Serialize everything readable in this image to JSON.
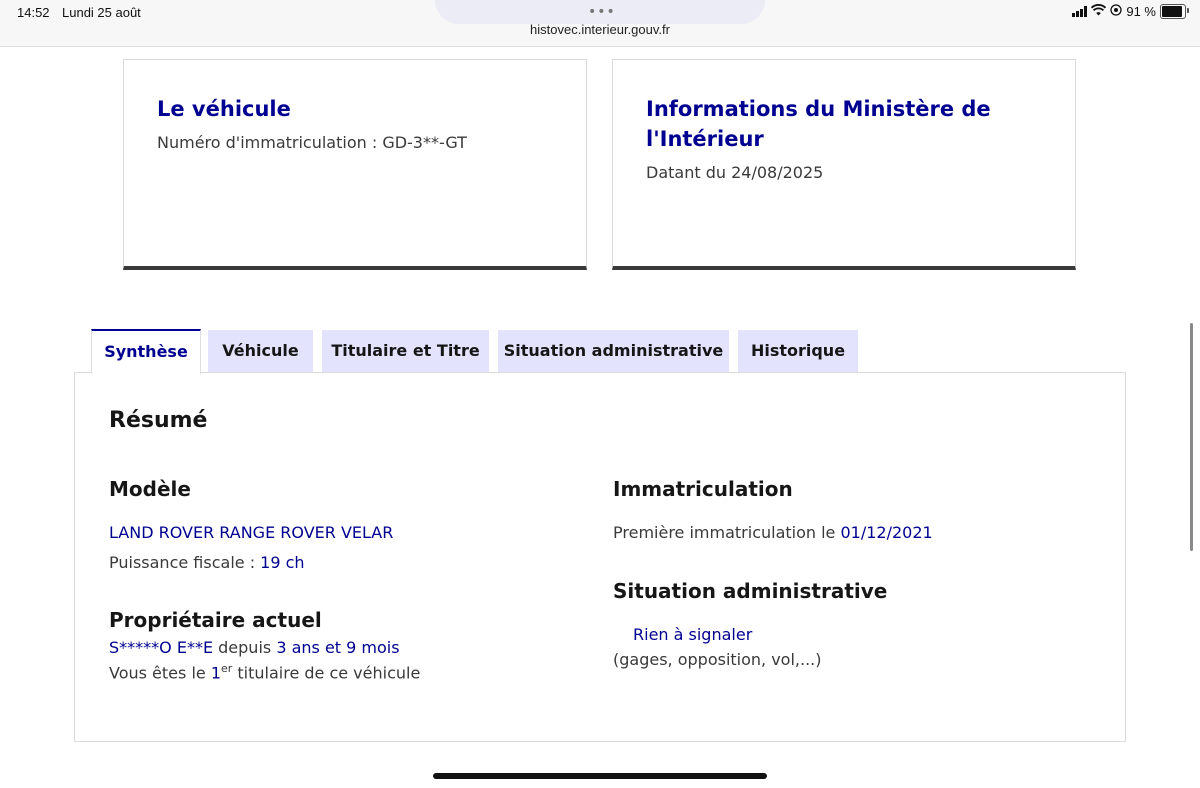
{
  "status_bar": {
    "time": "14:52",
    "date": "Lundi 25 août",
    "url": "histovec.interieur.gouv.fr",
    "battery": "91 %",
    "icons": [
      "more-dots-icon",
      "cellular-signal-icon",
      "wifi-icon",
      "location-icon",
      "battery-icon"
    ]
  },
  "cards": {
    "vehicle": {
      "title": "Le véhicule",
      "subtitle": "Numéro d'immatriculation : GD-3**-GT"
    },
    "ministry": {
      "title": "Informations du Ministère de l'Intérieur",
      "subtitle": "Datant du 24/08/2025"
    }
  },
  "tabs": [
    {
      "label": "Synthèse",
      "active": true
    },
    {
      "label": "Véhicule",
      "active": false
    },
    {
      "label": "Titulaire et Titre",
      "active": false
    },
    {
      "label": "Situation administrative",
      "active": false
    },
    {
      "label": "Historique",
      "active": false
    }
  ],
  "summary": {
    "title": "Résumé",
    "model": {
      "heading": "Modèle",
      "name": "LAND ROVER RANGE ROVER VELAR",
      "power_label": "Puissance fiscale : ",
      "power_value": "19 ch"
    },
    "owner": {
      "heading": "Propriétaire actuel",
      "name": "S*****O E**E",
      "since_label": " depuis ",
      "since_value": "3 ans et 9 mois",
      "rank_prefix": "Vous êtes le ",
      "rank_number": "1",
      "rank_sup": "er",
      "rank_suffix": " titulaire de ce véhicule"
    },
    "registration": {
      "heading": "Immatriculation",
      "label": "Première immatriculation le ",
      "date": "01/12/2021"
    },
    "admin": {
      "heading": "Situation administrative",
      "status": "Rien à signaler",
      "details": "(gages, opposition, vol,...)"
    }
  },
  "colors": {
    "accent_blue": "#000091",
    "tab_background": "#e3e3fd",
    "text": "#3a3a3a"
  }
}
